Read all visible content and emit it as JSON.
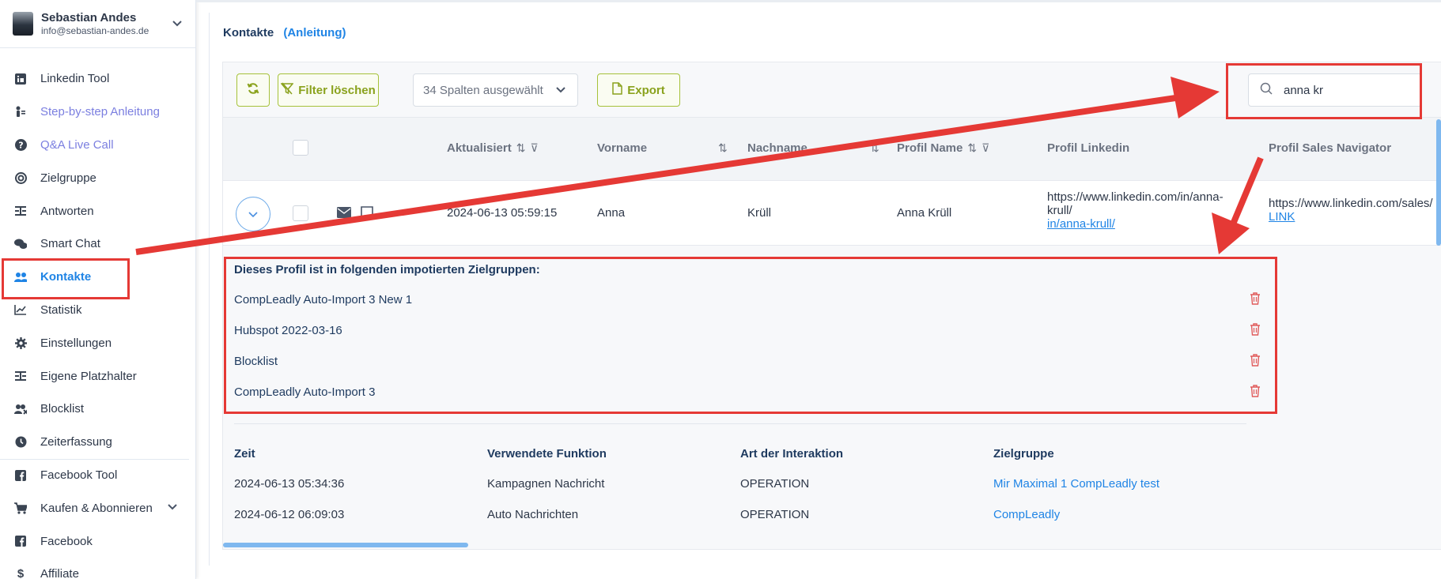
{
  "user": {
    "name": "Sebastian Andes",
    "email": "info@sebastian-andes.de"
  },
  "sidebar": {
    "items": [
      {
        "label": "Linkedin Tool",
        "icon": "linkedin-icon"
      },
      {
        "label": "Step-by-step Anleitung",
        "icon": "person-guide-icon"
      },
      {
        "label": "Q&A Live Call",
        "icon": "question-icon"
      },
      {
        "label": "Zielgruppe",
        "icon": "target-icon"
      },
      {
        "label": "Antworten",
        "icon": "reply-icon"
      },
      {
        "label": "Smart Chat",
        "icon": "chat-icon"
      },
      {
        "label": "Kontakte",
        "icon": "users-icon"
      },
      {
        "label": "Statistik",
        "icon": "chart-icon"
      },
      {
        "label": "Einstellungen",
        "icon": "gear-icon"
      },
      {
        "label": "Eigene Platzhalter",
        "icon": "placeholder-icon"
      },
      {
        "label": "Blocklist",
        "icon": "block-users-icon"
      },
      {
        "label": "Zeiterfassung",
        "icon": "clock-icon"
      },
      {
        "label": "Facebook Tool",
        "icon": "facebook-icon"
      },
      {
        "label": "Kaufen & Abonnieren",
        "icon": "cart-icon"
      },
      {
        "label": "Facebook",
        "icon": "facebook-icon"
      },
      {
        "label": "Affiliate",
        "icon": "dollar-icon"
      }
    ]
  },
  "page": {
    "title": "Kontakte",
    "guide_link": "(Anleitung)"
  },
  "toolbar": {
    "filter_label": "Filter löschen",
    "columns_select": "34 Spalten ausgewählt",
    "export_label": "Export",
    "search_value": "anna kr"
  },
  "table": {
    "headers": [
      "Aktualisiert",
      "Vorname",
      "Nachname",
      "Profil Name",
      "Profil Linkedin",
      "Profil Sales Navigator"
    ],
    "row": {
      "updated": "2024-06-13 05:59:15",
      "first": "Anna",
      "last": "Krüll",
      "profile_name": "Anna Krüll",
      "linkedin_line1": "https://www.linkedin.com/in/anna-",
      "linkedin_line2": "krull/",
      "linkedin_link": "in/anna-krull/",
      "sales_nav": "https://www.linkedin.com/sales/",
      "sales_link": "LINK"
    }
  },
  "details": {
    "zielgruppen_title": "Dieses Profil ist in folgenden impotierten Zielgruppen:",
    "zielgruppen": [
      "CompLeadly Auto-Import 3 New 1",
      "Hubspot 2022-03-16",
      "Blocklist",
      "CompLeadly Auto-Import 3"
    ],
    "interactions_headers": [
      "Zeit",
      "Verwendete Funktion",
      "Art der Interaktion",
      "Zielgruppe"
    ],
    "interactions": [
      [
        "2024-06-13 05:34:36",
        "Kampagnen Nachricht",
        "OPERATION",
        "Mir Maximal 1 CompLeadly test"
      ],
      [
        "2024-06-12 06:09:03",
        "Auto Nachrichten",
        "OPERATION",
        "CompLeadly"
      ]
    ]
  },
  "colors": {
    "accent": "#1f84e5",
    "button_green": "#8aa21d",
    "annotation_red": "#e53935"
  }
}
